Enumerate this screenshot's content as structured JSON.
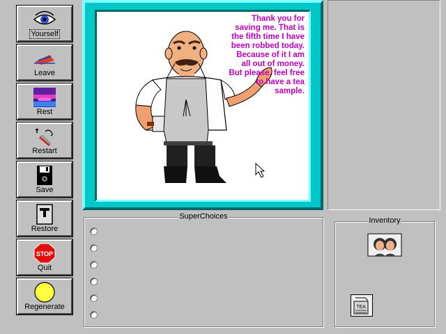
{
  "toolbar": {
    "yourself": "Yourself",
    "leave": "Leave",
    "rest": "Rest",
    "restart": "Restart",
    "save": "Save",
    "restore": "Restore",
    "quit": "Quit",
    "regenerate": "Regenerate",
    "stop_sign_text": "STOP"
  },
  "scene": {
    "speech": "Thank you for saving me. That is the fifth time I have been robbed today. Because of it I am all out of money. But please, feel free to have a tea sample."
  },
  "superchoices": {
    "title": "SuperChoices",
    "options": [
      "",
      "",
      "",
      "",
      "",
      ""
    ]
  },
  "inventory": {
    "title": "Inventory",
    "items": [
      "couple-photo",
      "tea-sample"
    ],
    "tea_label": "TEA"
  },
  "colors": {
    "frame": "#00c8c8",
    "speech": "#c000c0",
    "regenerate": "#ffff40"
  }
}
